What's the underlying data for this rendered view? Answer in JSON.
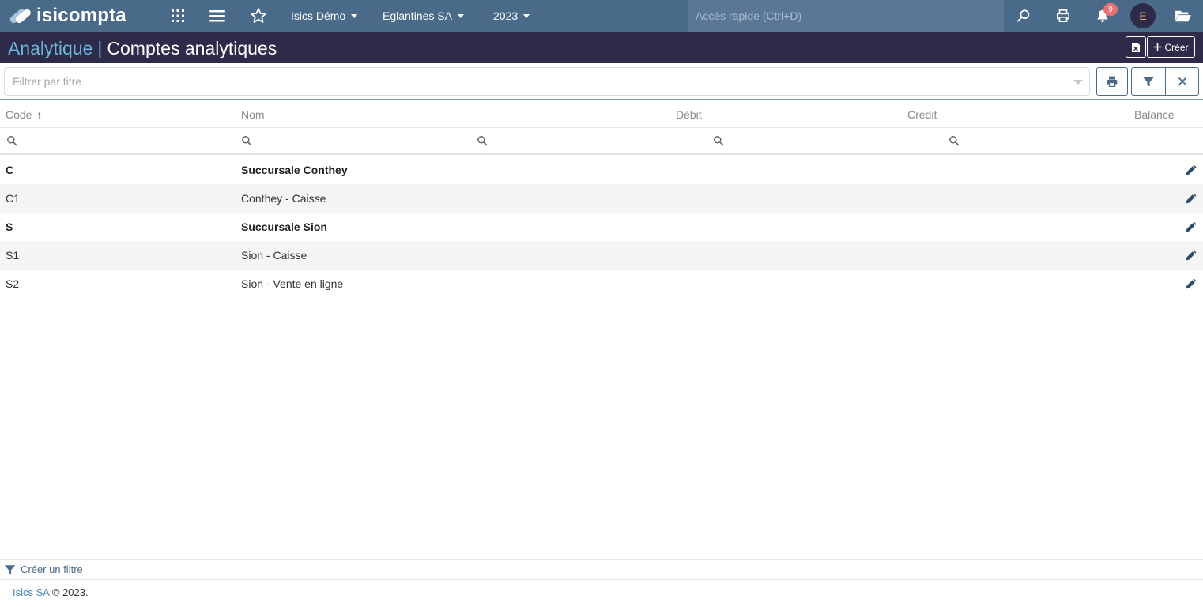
{
  "topnav": {
    "logo_text": "isicompta",
    "dropdowns": [
      {
        "label": "Isics Démo"
      },
      {
        "label": "Eglantines SA"
      },
      {
        "label": "2023"
      }
    ],
    "quick_access_placeholder": "Accès rapide (Ctrl+D)",
    "notifications_count": "9",
    "avatar_initial": "E",
    "icons": [
      "apps-grid-icon",
      "menu-icon",
      "star-icon",
      "search-icon",
      "print-icon",
      "bell-icon",
      "folder-open-icon"
    ]
  },
  "header": {
    "section": "Analytique",
    "separator": "|",
    "title": "Comptes analytiques",
    "create_label": "Créer"
  },
  "filter": {
    "placeholder": "Filtrer par titre"
  },
  "table": {
    "columns": [
      {
        "label": "Code"
      },
      {
        "label": "Nom"
      },
      {
        "label": "Débit"
      },
      {
        "label": "Crédit"
      },
      {
        "label": "Balance"
      }
    ],
    "sort_indicator": "↑",
    "rows": [
      {
        "code": "C",
        "nom": "Succursale Conthey",
        "bold": true
      },
      {
        "code": "C1",
        "nom": "Conthey - Caisse",
        "bold": false
      },
      {
        "code": "S",
        "nom": "Succursale Sion",
        "bold": true
      },
      {
        "code": "S1",
        "nom": "Sion - Caisse",
        "bold": false
      },
      {
        "code": "S2",
        "nom": "Sion - Vente en ligne",
        "bold": false
      }
    ]
  },
  "bottom": {
    "create_filter_label": "Créer un filtre"
  },
  "footer": {
    "company": "Isics SA",
    "copyright": "© 2023."
  },
  "colors": {
    "topnav_bg": "#4a6a8a",
    "header_bg": "#2e2a4a",
    "accent": "#6ab4d8"
  }
}
